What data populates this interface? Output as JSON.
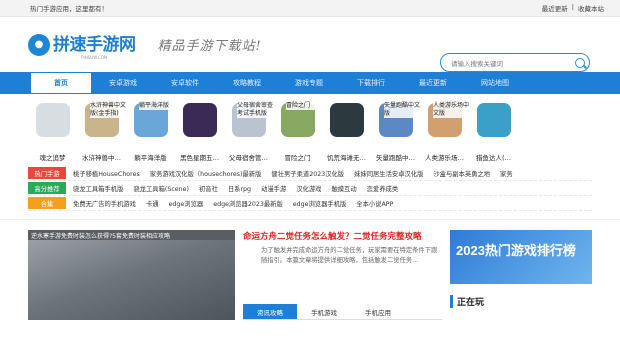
{
  "topbar": {
    "left": "热门手游应用，这里都有！",
    "links": [
      "最近更新",
      "收藏本站"
    ],
    "sep": "|"
  },
  "logo": {
    "name": "拼速手游网",
    "sub": "PINSUW.COM"
  },
  "slogan": "精品手游下载站!",
  "search": {
    "placeholder": "请输入搜索关键词"
  },
  "nav": [
    "首页",
    "安卓游戏",
    "安卓软件",
    "攻略教程",
    "游戏专题",
    "下载排行",
    "最近更新",
    "网站地图"
  ],
  "games": [
    {
      "label": "魂之追梦",
      "tip": "",
      "color": "#d8dde2"
    },
    {
      "label": "水浒神兽中…",
      "tip": "水浒神兽中文版(金手指)",
      "color": "#c9b48c"
    },
    {
      "label": "躺平海洋版",
      "tip": "躺平海洋版",
      "color": "#6aa7d8"
    },
    {
      "label": "黑色星期五…",
      "tip": "",
      "color": "#3a2a55"
    },
    {
      "label": "父母宿舍管…",
      "tip": "父母宿舍审查考试手机版",
      "color": "#b9c4d0"
    },
    {
      "label": "冒险之门",
      "tip": "冒险之门",
      "color": "#86a860"
    },
    {
      "label": "饥荒海滩无…",
      "tip": "",
      "color": "#2c3a40"
    },
    {
      "label": "矢量跑酷中…",
      "tip": "矢量跑酷中文版",
      "color": "#5c88c4"
    },
    {
      "label": "人类游乐场…",
      "tip": "人类游乐场中文版",
      "color": "#d2a070"
    },
    {
      "label": "猎鱼达人(…",
      "tip": "",
      "color": "#3aa0c8"
    }
  ],
  "tag_rows": [
    {
      "head": "热门手游",
      "color": "#e8483b",
      "items": [
        "桃子移植HouseChores",
        "家务游戏汉化版（housechores)最新版",
        "健壮男子柔道2023汉化版",
        "妹妹同居生活安卓汉化版",
        "沙盒与副本英勇之地",
        "家务"
      ]
    },
    {
      "head": "高分推荐",
      "color": "#2ba95a",
      "items": [
        "骁龙工具箱手机版",
        "骁龙工具箱(Scene)",
        "初音社",
        "日系rpg",
        "动漫手游",
        "汉化游戏",
        "触摸互动",
        "恋爱养成类"
      ]
    },
    {
      "head": "合集",
      "color": "#f2a21a",
      "items": [
        "免费无广告的手机游戏",
        "卡通",
        "edge浏览器",
        "edge浏览器2023最新版",
        "edge浏览器手机版",
        "全本小说APP"
      ]
    }
  ],
  "slide": {
    "caption": "逆水寒手游免费时装怎么获得?5套免费时装相应攻略"
  },
  "news": {
    "headline": "命运方舟二觉任务怎么触发？二觉任务完整攻略",
    "desc": "为了触发并完成命运方舟的二觉任务，玩家需要在特定条件下跟随指引。本篇文章将提供详细攻略，包括触发二觉任务...",
    "tabs": [
      "资讯攻略",
      "手机游戏",
      "手机应用"
    ]
  },
  "side": {
    "banner": "2023热门游戏排行榜",
    "playing": "正在玩"
  }
}
